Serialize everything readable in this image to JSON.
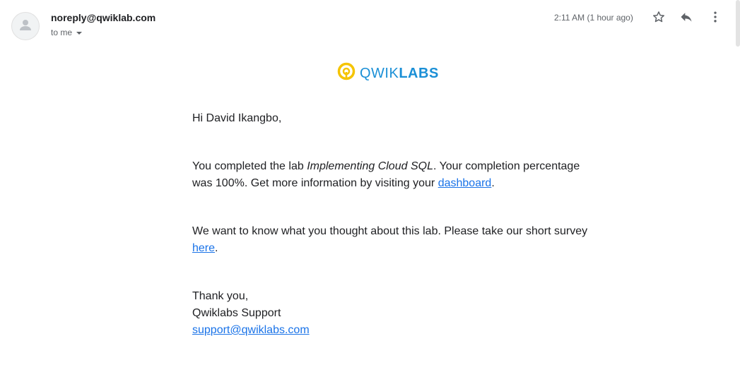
{
  "header": {
    "sender": "noreply@qwiklab.com",
    "recipient": "to me",
    "timestamp": "2:11 AM (1 hour ago)",
    "icons": [
      "person-icon",
      "caret-down-icon",
      "star-icon",
      "reply-icon",
      "more-vert-icon"
    ]
  },
  "logo": {
    "part1": "QWIK",
    "part2": "LABS",
    "colors": {
      "ring": "#f5c400",
      "text": "#1a8fd6"
    }
  },
  "body": {
    "greeting": "Hi David Ikangbo,",
    "completed_prefix": "You completed the lab ",
    "lab_name": "Implementing Cloud SQL",
    "completed_middle": ". Your completion percentage was 100%. Get more information by visiting your ",
    "dashboard_link": "dashboard",
    "completed_suffix": ".",
    "survey_prefix": "We want to know what you thought about this lab. Please take our short survey ",
    "survey_link": "here",
    "survey_suffix": ".",
    "signoff": "Thank you,",
    "signature": "Qwiklabs Support",
    "support_email": "support@qwiklabs.com"
  },
  "colors": {
    "link": "#1a73e8",
    "muted": "#5f6368",
    "text": "#202124"
  }
}
